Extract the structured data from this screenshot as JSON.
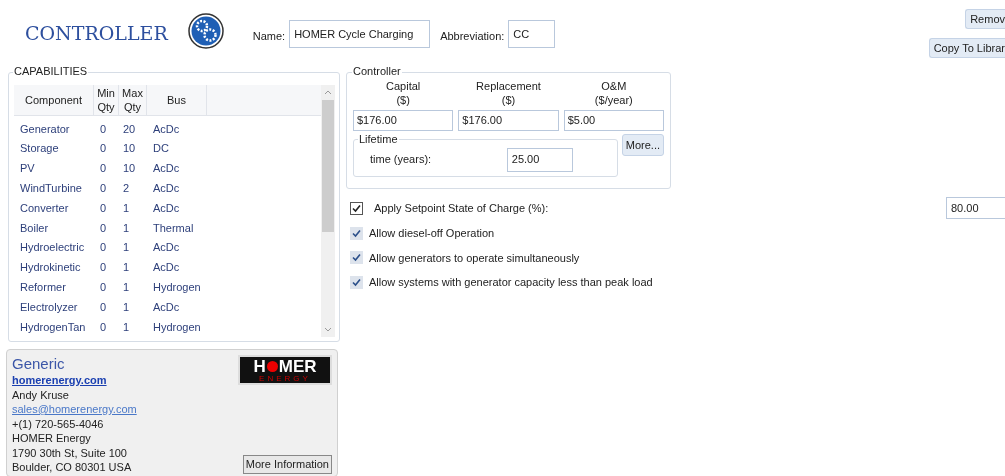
{
  "header": {
    "title": "CONTROLLER",
    "name_label": "Name:",
    "name_value": "HOMER Cycle Charging",
    "abbreviation_label": "Abbreviation:",
    "abbreviation_value": "CC"
  },
  "top_buttons": [
    "Remov",
    "Copy To Librar"
  ],
  "capabilities": {
    "title": "CAPABILITIES",
    "columns": [
      "Component",
      "Min Qty",
      "Max Qty",
      "Bus"
    ],
    "rows": [
      [
        "Generator",
        "0",
        "20",
        "AcDc"
      ],
      [
        "Storage",
        "0",
        "10",
        "DC"
      ],
      [
        "PV",
        "0",
        "10",
        "AcDc"
      ],
      [
        "WindTurbine",
        "0",
        "2",
        "AcDc"
      ],
      [
        "Converter",
        "0",
        "1",
        "AcDc"
      ],
      [
        "Boiler",
        "0",
        "1",
        "Thermal"
      ],
      [
        "Hydroelectric",
        "0",
        "1",
        "AcDc"
      ],
      [
        "Hydrokinetic",
        "0",
        "1",
        "AcDc"
      ],
      [
        "Reformer",
        "0",
        "1",
        "Hydrogen"
      ],
      [
        "Electrolyzer",
        "0",
        "1",
        "AcDc"
      ],
      [
        "HydrogenTan",
        "0",
        "1",
        "Hydrogen"
      ]
    ]
  },
  "manufacturer": {
    "name": "Generic",
    "website": "homerenergy.com",
    "contact": "Andy Kruse",
    "email": "sales@homerenergy.com",
    "phone": "+(1) 720-565-4046",
    "company": "HOMER Energy",
    "address1": "1790 30th St, Suite 100",
    "address2": "Boulder, CO 80301 USA",
    "logo": {
      "start": "H",
      "end": "MER",
      "sub": "ENERGY"
    },
    "button": "More Information"
  },
  "controller": {
    "title": "Controller",
    "costs": [
      {
        "label": [
          "Capital",
          "($)"
        ],
        "value": "$176.00"
      },
      {
        "label": [
          "Replacement",
          "($)"
        ],
        "value": "$176.00"
      },
      {
        "label": [
          "O&M",
          "($/year)"
        ],
        "value": "$5.00"
      }
    ],
    "lifetime_title": "Lifetime",
    "lifetime_label": "time (years):",
    "lifetime_value": "25.00",
    "more_button": "More..."
  },
  "setpoint": {
    "label": "Apply Setpoint State of Charge (%):",
    "checked": true,
    "value": "80.00"
  },
  "options": [
    {
      "label": "Allow diesel-off Operation",
      "checked": true
    },
    {
      "label": "Allow generators to operate simultaneously",
      "checked": true
    },
    {
      "label": "Allow systems with generator capacity less than peak load",
      "checked": true
    }
  ]
}
